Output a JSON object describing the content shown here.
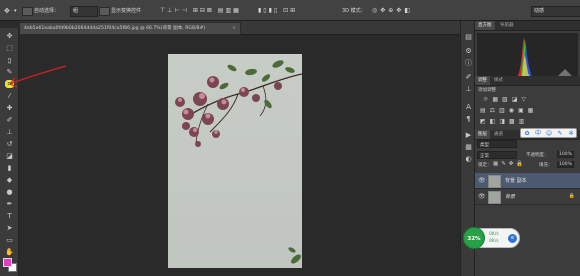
{
  "options_bar": {
    "auto_select_label": "自动选择：",
    "auto_select_value": "组",
    "transform_label": "显示变换控件",
    "mode_3d_label": "3D 模式：",
    "workspace_value": "动感"
  },
  "document": {
    "tab_title": "4eb5e61eaba0fd9b0b2064d44a251f04ca5f86.jpg @ 66.7%(背景 副本, RGB/8#)",
    "close_glyph": "×"
  },
  "panels": {
    "histogram_tabs": [
      "直方图",
      "导航器"
    ],
    "adjust_tabs": [
      "调整",
      "样式"
    ],
    "adjust_title": "添加调整",
    "layers_tabs": [
      "图层",
      "通道"
    ],
    "layers_kind": "类型",
    "blend_mode": "正常",
    "opacity_label": "不透明度：",
    "opacity_value": "100%",
    "lock_label": "锁定：",
    "fill_label": "填充：",
    "fill_value": "100%",
    "layers": [
      {
        "name": "背景 副本",
        "selected": true
      },
      {
        "name": "背景",
        "selected": false
      }
    ]
  },
  "widget": {
    "percent": "32%",
    "stat1": "0K/s",
    "stat2": "0K/s"
  },
  "colors": {
    "foreground": "#e53fbf",
    "background": "#ffffff",
    "accent_blue": "#2e72d6",
    "badge_green": "#27a048",
    "selected_layer": "#4b5a70"
  },
  "icons": {
    "toolbar": [
      "move-icon",
      "marquee-icon",
      "lasso-icon",
      "quick-select-icon",
      "crop-icon",
      "eyedropper-icon",
      "healing-icon",
      "brush-icon",
      "stamp-icon",
      "history-brush-icon",
      "eraser-icon",
      "gradient-icon",
      "blur-icon",
      "dodge-icon",
      "pen-icon",
      "type-icon",
      "path-select-icon",
      "shape-icon",
      "hand-icon",
      "zoom-icon"
    ]
  }
}
